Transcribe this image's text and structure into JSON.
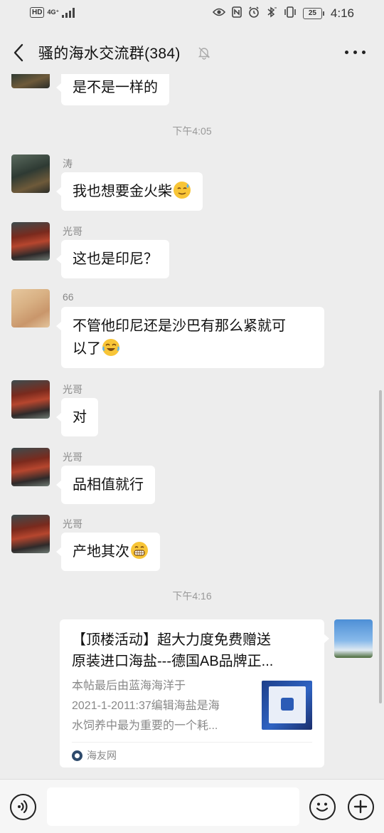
{
  "status_bar": {
    "hd": "HD",
    "network": "4G⁺",
    "battery": "25",
    "time": "4:16"
  },
  "header": {
    "title": "骚的海水交流群(384)"
  },
  "messages": [
    {
      "text": "是不是一样的"
    },
    {
      "time": "下午4:05"
    },
    {
      "sender": "涛",
      "text": "我也想要金火柴"
    },
    {
      "sender": "光哥",
      "text": "这也是印尼？"
    },
    {
      "sender": "66",
      "text_line1": "不管他印尼还是沙巴有那么紧就可",
      "text_line2": "以了"
    },
    {
      "sender": "光哥",
      "text": "对"
    },
    {
      "sender": "光哥",
      "text": "品相值就行"
    },
    {
      "sender": "光哥",
      "text": "产地其次"
    },
    {
      "time": "下午4:16"
    }
  ],
  "link_card": {
    "title_line1": "【顶楼活动】超大力度免费赠送",
    "title_line2": "原装进口海盐---德国AB品牌正...",
    "desc_line1": "本帖最后由蓝海海洋于",
    "desc_line2": "2021-1-2011:37编辑海盐是海",
    "desc_line3": "水饲养中最为重要的一个耗...",
    "source": "海友网"
  },
  "icons": {
    "back": "back-arrow-icon",
    "mute": "mute-bell-icon",
    "more": "more-dots-icon",
    "voice": "voice-icon",
    "emoji": "emoji-icon",
    "plus": "plus-icon"
  }
}
